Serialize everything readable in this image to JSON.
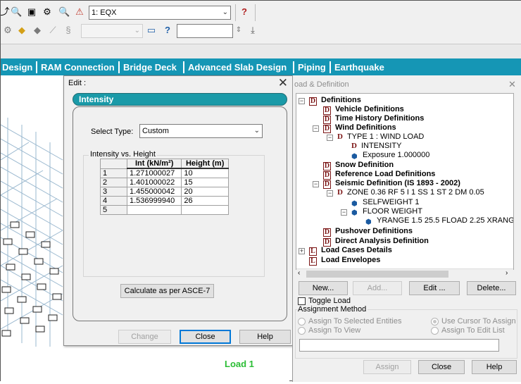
{
  "toolbar": {
    "load_case_select": "1: EQX",
    "row2_select": "",
    "row2_input": ""
  },
  "tabs": [
    "Design",
    "RAM Connection",
    "Bridge Deck",
    "Advanced Slab Design",
    "Piping",
    "Earthquake"
  ],
  "viewport": {
    "load_label": "Load 1"
  },
  "dialog": {
    "title": "Edit :",
    "banner": "Intensity",
    "select_type_label": "Select Type:",
    "select_type_value": "Custom",
    "group_label": "Intensity vs. Height",
    "table": {
      "headers": [
        "Int (kN/m²)",
        "Height (m)"
      ],
      "rows": [
        {
          "n": "1",
          "int": "1.271000027",
          "height": "10"
        },
        {
          "n": "2",
          "int": "1.401000022",
          "height": "15"
        },
        {
          "n": "3",
          "int": "1.455000042",
          "height": "20"
        },
        {
          "n": "4",
          "int": "1.536999940",
          "height": "26"
        },
        {
          "n": "5",
          "int": "",
          "height": ""
        }
      ]
    },
    "calc_button": "Calculate as per ASCE-7",
    "change_button": "Change",
    "close_button": "Close",
    "help_button": "Help"
  },
  "right_panel": {
    "title": "oad & Definition",
    "tree": {
      "definitions": "Definitions",
      "vehicle": "Vehicle Definitions",
      "time_history": "Time History Definitions",
      "wind": "Wind Definitions",
      "type1": "TYPE 1 : WIND LOAD",
      "intensity": "INTENSITY",
      "exposure": "Exposure 1.000000",
      "snow": "Snow Definition",
      "reference": "Reference Load Definitions",
      "seismic": "Seismic Definition (IS 1893 - 2002)",
      "zone": "ZONE 0.36 RF 5 I 1 SS 1 ST 2 DM 0.05",
      "selfweight": "SELFWEIGHT 1",
      "floorweight": "FLOOR WEIGHT",
      "yrange": "YRANGE 1.5 25.5 FLOAD 2.25 XRANG",
      "pushover": "Pushover Definitions",
      "direct": "Direct Analysis Definition",
      "load_cases": "Load Cases Details",
      "envelopes": "Load Envelopes"
    },
    "buttons": {
      "new": "New...",
      "add": "Add...",
      "edit": "Edit ...",
      "delete": "Delete..."
    },
    "toggle_load": "Toggle Load",
    "assignment_method": "Assignment Method",
    "radios": {
      "selected_entities": "Assign To Selected Entities",
      "cursor": "Use Cursor To Assign",
      "view": "Assign To View",
      "edit_list": "Assign To Edit List"
    },
    "bottom": {
      "assign": "Assign",
      "close": "Close",
      "help": "Help"
    }
  },
  "colors": {
    "tab_bar": "#1596b5",
    "banner": "#1a9aa8",
    "def_icon": "#7b1515",
    "load_label": "#2bbd35"
  }
}
